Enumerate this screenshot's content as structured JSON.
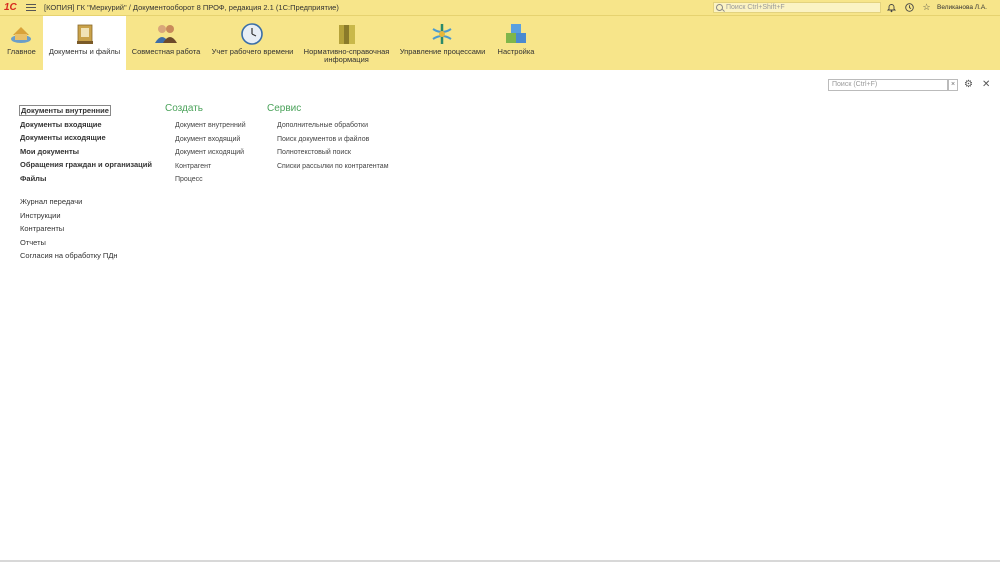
{
  "titlebar": {
    "logo": "1С",
    "window_title": "[КОПИЯ] ГК \"Меркурий\" / Документооборот 8 ПРОФ, редакция 2.1  (1С:Предприятие)",
    "search_placeholder": "Поиск Ctrl+Shift+F",
    "user_name": "Великанова Л.А."
  },
  "sections": [
    {
      "label": "Главное",
      "icon": "home-icon"
    },
    {
      "label": "Документы и файлы",
      "icon": "documents-icon",
      "active": true
    },
    {
      "label": "Совместная работа",
      "icon": "people-icon"
    },
    {
      "label": "Учет рабочего времени",
      "icon": "clock-icon"
    },
    {
      "label": "Нормативно-справочная информация",
      "icon": "books-icon"
    },
    {
      "label": "Управление процессами",
      "icon": "process-icon"
    },
    {
      "label": "Настройка",
      "icon": "settings-blocks-icon"
    }
  ],
  "panel": {
    "search_placeholder": "Поиск (Ctrl+F)",
    "clear": "×"
  },
  "nav_bold": [
    "Документы внутренние",
    "Документы входящие",
    "Документы исходящие",
    "Мои документы",
    "Обращения граждан и организаций",
    "Файлы"
  ],
  "nav_plain": [
    "Журнал передачи",
    "Инструкции",
    "Контрагенты",
    "Отчеты",
    "Согласия на обработку ПДн"
  ],
  "create": {
    "title": "Создать",
    "items": [
      "Документ внутренний",
      "Документ входящий",
      "Документ исходящий",
      "Контрагент",
      "Процесс"
    ]
  },
  "service": {
    "title": "Сервис",
    "items": [
      "Дополнительные обработки",
      "Поиск документов и файлов",
      "Полнотекстовый поиск",
      "Списки рассылки по контрагентам"
    ]
  },
  "colors": {
    "accent_bar": "#f7e58a",
    "group_title": "#4aa25a"
  }
}
